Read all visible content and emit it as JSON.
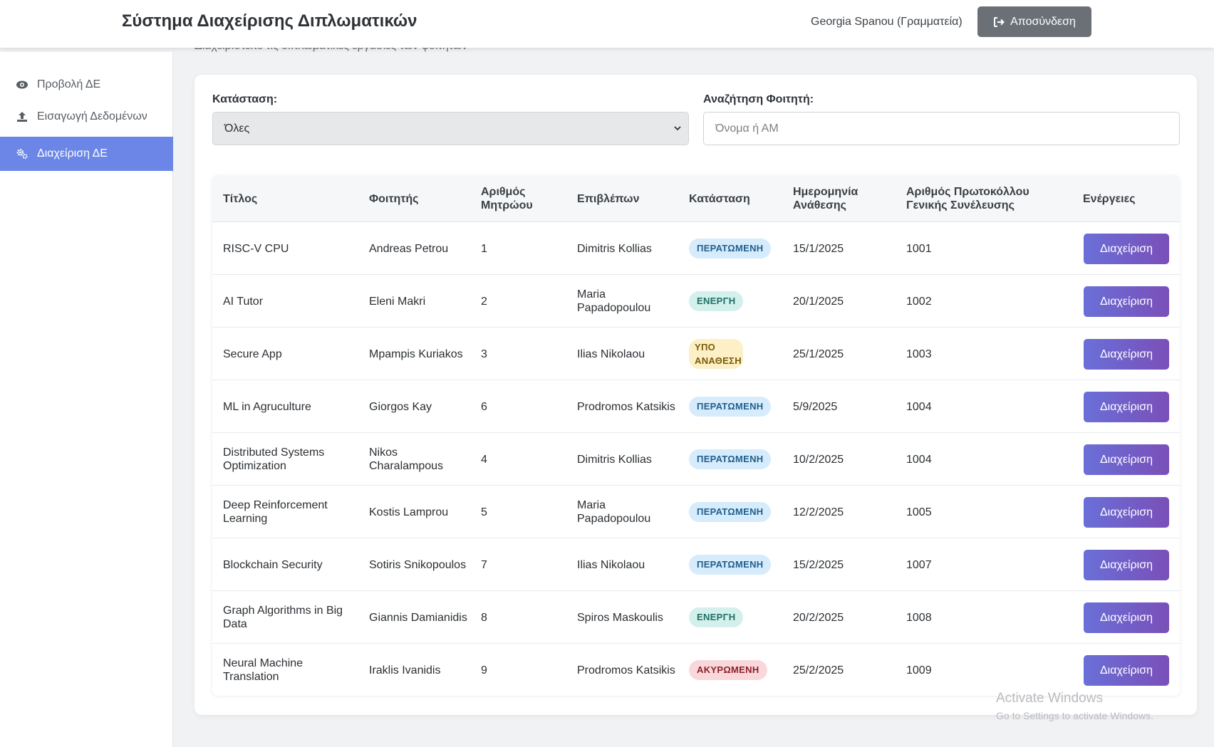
{
  "header": {
    "title": "Σύστημα Διαχείρισης Διπλωματικών",
    "user": "Georgia Spanou (Γραμματεία)",
    "logout_label": "Αποσύνδεση"
  },
  "sidebar": {
    "items": [
      {
        "label": "Προβολή ΔΕ",
        "icon": "eye-icon"
      },
      {
        "label": "Εισαγωγή Δεδομένων",
        "icon": "upload-icon"
      },
      {
        "label": "Διαχείριση ΔΕ",
        "icon": "cogs-icon",
        "active": true
      }
    ]
  },
  "page": {
    "subtitle": "Διαχειριστείτε τις διπλωματικές εργασίες των φοιτητών"
  },
  "filters": {
    "status_label": "Κατάσταση:",
    "status_value": "Όλες",
    "search_label": "Αναζήτηση Φοιτητή:",
    "search_placeholder": "Όνομα ή ΑΜ"
  },
  "table": {
    "columns": [
      "Τίτλος",
      "Φοιτητής",
      "Αριθμός Μητρώου",
      "Επιβλέπων",
      "Κατάσταση",
      "Ημερομηνία Ανάθεσης",
      "Αριθμός Πρωτοκόλλου Γενικής Συνέλευσης",
      "Ενέργειες"
    ],
    "action_label": "Διαχείριση",
    "rows": [
      {
        "title": "RISC-V CPU",
        "student": "Andreas Petrou",
        "am": "1",
        "supervisor": "Dimitris Kollias",
        "status": "ΠΕΡΑΤΩΜΕΝΗ",
        "status_kind": "done",
        "date": "15/1/2025",
        "protocol": "1001"
      },
      {
        "title": "AI Tutor",
        "student": "Eleni Makri",
        "am": "2",
        "supervisor": "Maria Papadopoulou",
        "status": "ΕΝΕΡΓΗ",
        "status_kind": "active",
        "date": "20/1/2025",
        "protocol": "1002"
      },
      {
        "title": "Secure App",
        "student": "Mpampis Kuriakos",
        "am": "3",
        "supervisor": "Ilias Nikolaou",
        "status": "ΥΠΟ ΑΝΑΘΕΣΗ",
        "status_kind": "pending",
        "date": "25/1/2025",
        "protocol": "1003"
      },
      {
        "title": "ML in Agruculture",
        "student": "Giorgos Kay",
        "am": "6",
        "supervisor": "Prodromos Katsikis",
        "status": "ΠΕΡΑΤΩΜΕΝΗ",
        "status_kind": "done",
        "date": "5/9/2025",
        "protocol": "1004"
      },
      {
        "title": "Distributed Systems Optimization",
        "student": "Nikos Charalampous",
        "am": "4",
        "supervisor": "Dimitris Kollias",
        "status": "ΠΕΡΑΤΩΜΕΝΗ",
        "status_kind": "done",
        "date": "10/2/2025",
        "protocol": "1004"
      },
      {
        "title": "Deep Reinforcement Learning",
        "student": "Kostis Lamprou",
        "am": "5",
        "supervisor": "Maria Papadopoulou",
        "status": "ΠΕΡΑΤΩΜΕΝΗ",
        "status_kind": "done",
        "date": "12/2/2025",
        "protocol": "1005"
      },
      {
        "title": "Blockchain Security",
        "student": "Sotiris Snikopoulos",
        "am": "7",
        "supervisor": "Ilias Nikolaou",
        "status": "ΠΕΡΑΤΩΜΕΝΗ",
        "status_kind": "done",
        "date": "15/2/2025",
        "protocol": "1007"
      },
      {
        "title": "Graph Algorithms in Big Data",
        "student": "Giannis Damianidis",
        "am": "8",
        "supervisor": "Spiros Maskoulis",
        "status": "ΕΝΕΡΓΗ",
        "status_kind": "active",
        "date": "20/2/2025",
        "protocol": "1008"
      },
      {
        "title": "Neural Machine Translation",
        "student": "Iraklis Ivanidis",
        "am": "9",
        "supervisor": "Prodromos Katsikis",
        "status": "ΑΚΥΡΩΜΕΝΗ",
        "status_kind": "cancel",
        "date": "25/2/2025",
        "protocol": "1009"
      }
    ]
  },
  "watermark": {
    "line1": "Activate Windows",
    "line2": "Go to Settings to activate Windows."
  }
}
